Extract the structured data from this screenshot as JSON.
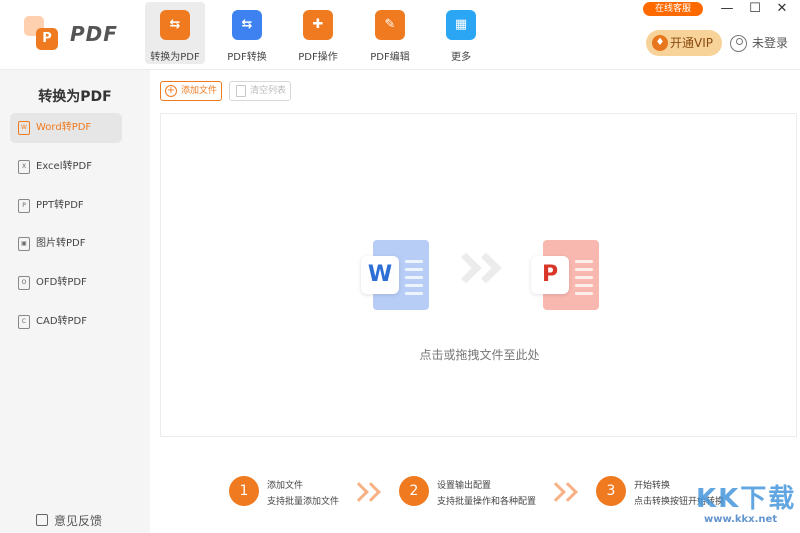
{
  "app": {
    "logo_text": "PDF",
    "logo_glyph": "P"
  },
  "tabs": [
    {
      "label": "转换为PDF",
      "glyph": "⇆",
      "color": "#f07a1f"
    },
    {
      "label": "PDF转换",
      "glyph": "⇆",
      "color": "#3d82f0"
    },
    {
      "label": "PDF操作",
      "glyph": "✚",
      "color": "#f07a1f"
    },
    {
      "label": "PDF编辑",
      "glyph": "✎",
      "color": "#f07a1f"
    },
    {
      "label": "更多",
      "glyph": "▦",
      "color": "#2aa6f5"
    }
  ],
  "header": {
    "service_label": "在线客服",
    "minimize": "—",
    "maximize": "☐",
    "close": "✕",
    "vip_label": "开通VIP",
    "vip_glyph": "♦",
    "login_label": "未登录"
  },
  "sidebar": {
    "title": "转换为PDF",
    "items": [
      {
        "label": "Word转PDF",
        "glyph": "W"
      },
      {
        "label": "Excel转PDF",
        "glyph": "X"
      },
      {
        "label": "PPT转PDF",
        "glyph": "P"
      },
      {
        "label": "图片转PDF",
        "glyph": "▣"
      },
      {
        "label": "OFD转PDF",
        "glyph": "O"
      },
      {
        "label": "CAD转PDF",
        "glyph": "C"
      }
    ],
    "feedback_label": "意见反馈"
  },
  "toolbar": {
    "add_label": "添加文件",
    "add_glyph": "+",
    "clear_label": "清空列表"
  },
  "dropzone": {
    "source_glyph": "W",
    "source_color": "#2b6fd6",
    "source_back": "#b8cdf6",
    "target_glyph": "P",
    "target_color": "#d9362a",
    "target_back": "#f8b8b0",
    "hint": "点击或拖拽文件至此处"
  },
  "steps": [
    {
      "num": "1",
      "title": "添加文件",
      "desc": "支持批量添加文件"
    },
    {
      "num": "2",
      "title": "设置输出配置",
      "desc": "支持批量操作和各种配置"
    },
    {
      "num": "3",
      "title": "开始转换",
      "desc": "点击转换按钮开始转换"
    }
  ],
  "watermark": {
    "text": "KK下载",
    "url": "www.kkx.net"
  }
}
